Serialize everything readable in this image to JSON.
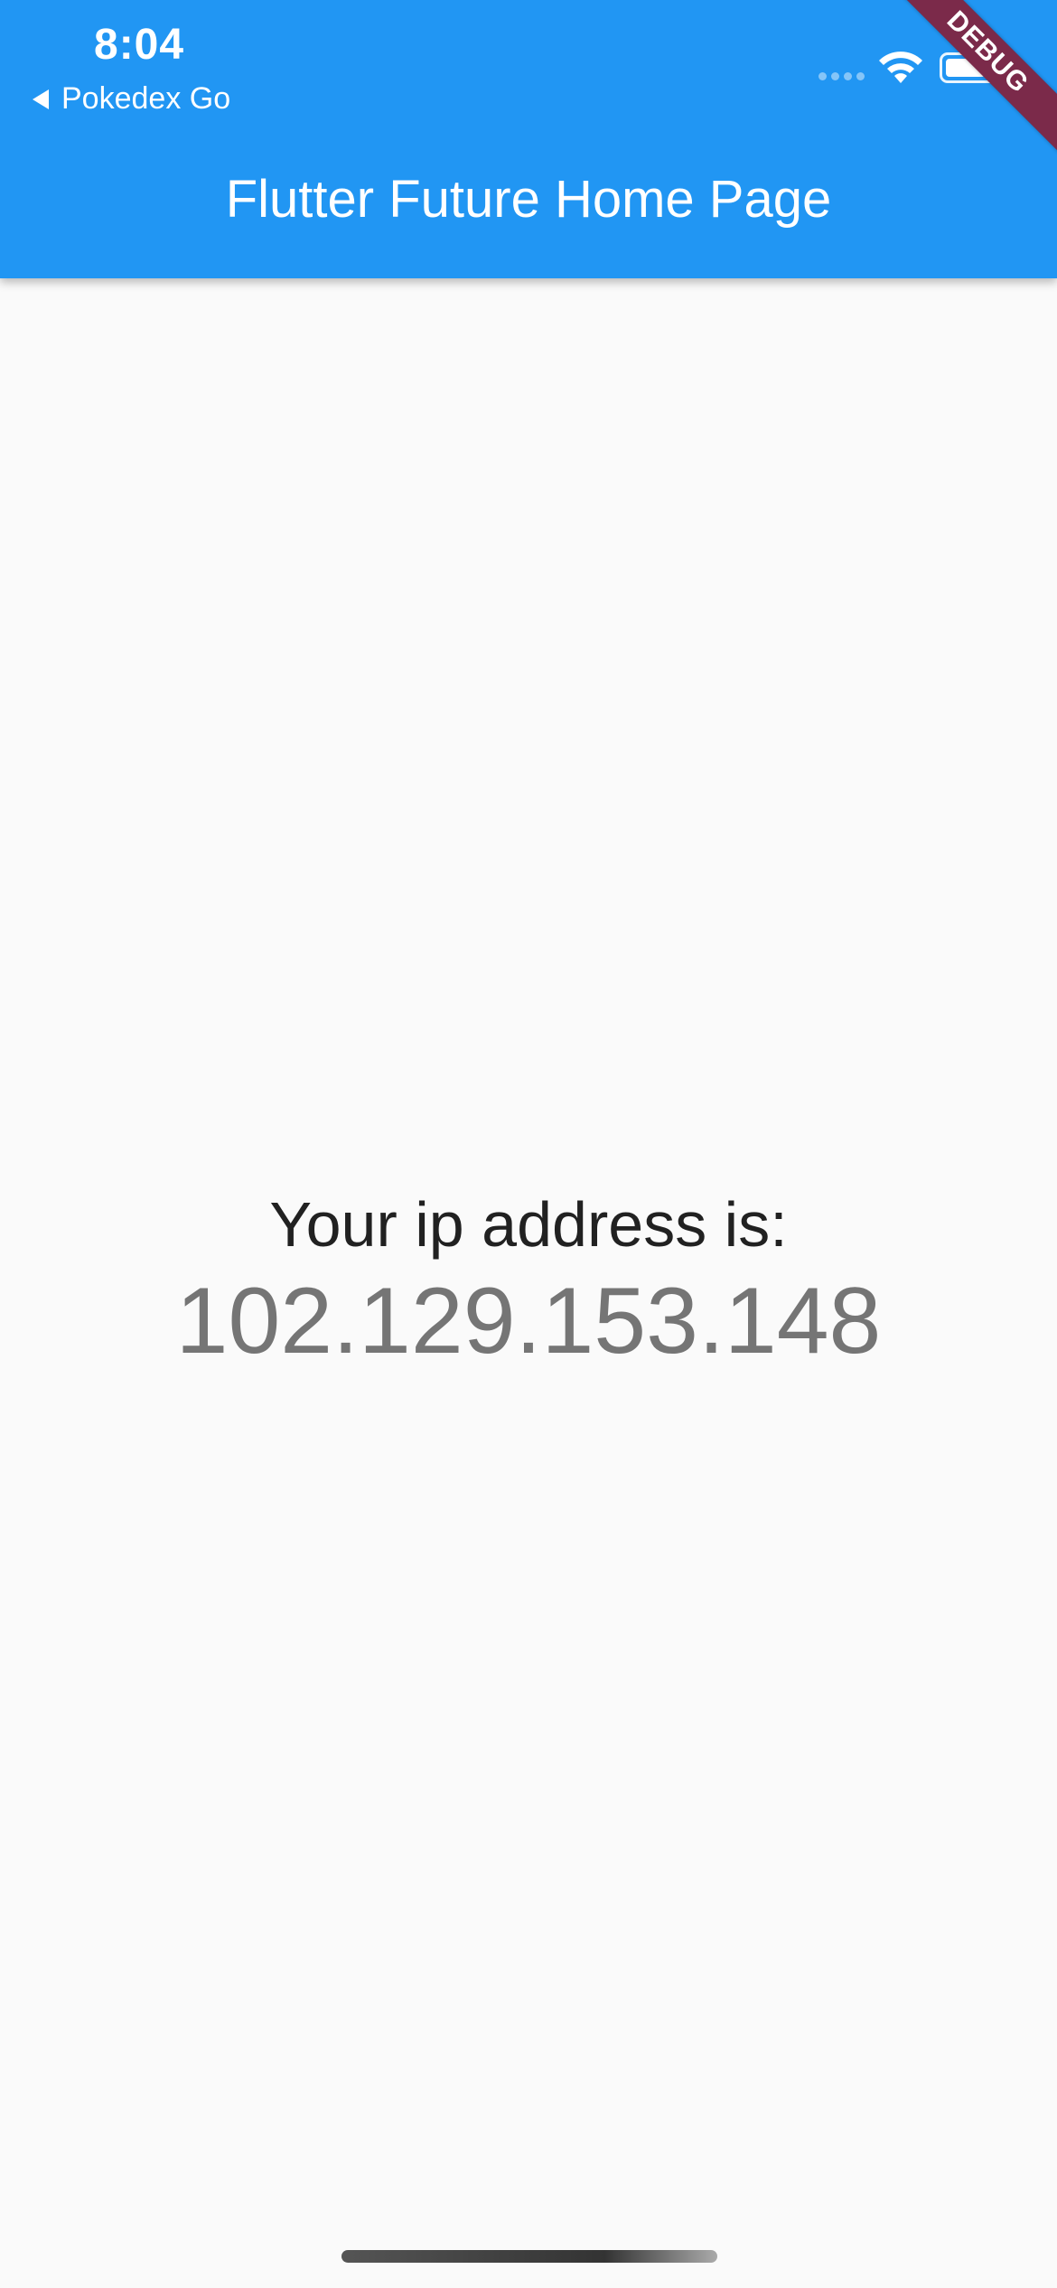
{
  "status_bar": {
    "time": "8:04",
    "back_app_label": "Pokedex Go",
    "icons": [
      "signal-dots-icon",
      "wifi-icon",
      "battery-icon"
    ]
  },
  "debug_banner": {
    "label": "DEBUG",
    "color": "#7b2a4a"
  },
  "app_bar": {
    "title": "Flutter Future Home Page",
    "color": "#2196f3"
  },
  "main": {
    "label": "Your ip address is:",
    "ip_address": "102.129.153.148"
  }
}
